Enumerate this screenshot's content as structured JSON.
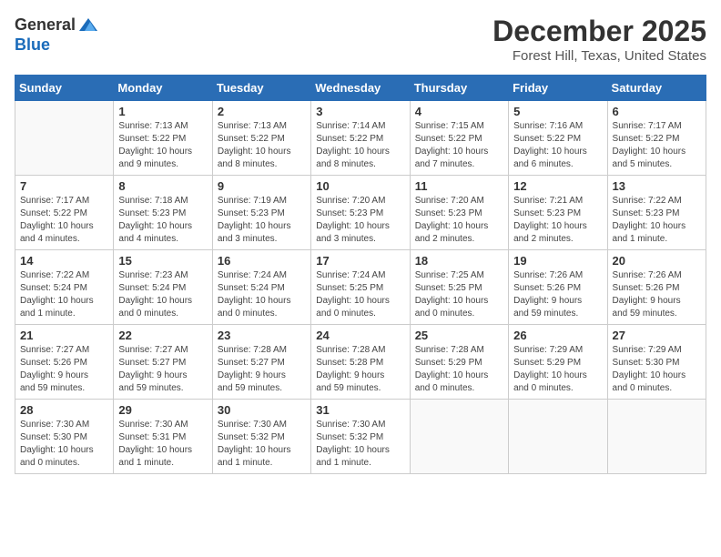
{
  "logo": {
    "general": "General",
    "blue": "Blue"
  },
  "title": "December 2025",
  "location": "Forest Hill, Texas, United States",
  "days_header": [
    "Sunday",
    "Monday",
    "Tuesday",
    "Wednesday",
    "Thursday",
    "Friday",
    "Saturday"
  ],
  "weeks": [
    [
      {
        "num": "",
        "info": ""
      },
      {
        "num": "1",
        "info": "Sunrise: 7:13 AM\nSunset: 5:22 PM\nDaylight: 10 hours\nand 9 minutes."
      },
      {
        "num": "2",
        "info": "Sunrise: 7:13 AM\nSunset: 5:22 PM\nDaylight: 10 hours\nand 8 minutes."
      },
      {
        "num": "3",
        "info": "Sunrise: 7:14 AM\nSunset: 5:22 PM\nDaylight: 10 hours\nand 8 minutes."
      },
      {
        "num": "4",
        "info": "Sunrise: 7:15 AM\nSunset: 5:22 PM\nDaylight: 10 hours\nand 7 minutes."
      },
      {
        "num": "5",
        "info": "Sunrise: 7:16 AM\nSunset: 5:22 PM\nDaylight: 10 hours\nand 6 minutes."
      },
      {
        "num": "6",
        "info": "Sunrise: 7:17 AM\nSunset: 5:22 PM\nDaylight: 10 hours\nand 5 minutes."
      }
    ],
    [
      {
        "num": "7",
        "info": "Sunrise: 7:17 AM\nSunset: 5:22 PM\nDaylight: 10 hours\nand 4 minutes."
      },
      {
        "num": "8",
        "info": "Sunrise: 7:18 AM\nSunset: 5:23 PM\nDaylight: 10 hours\nand 4 minutes."
      },
      {
        "num": "9",
        "info": "Sunrise: 7:19 AM\nSunset: 5:23 PM\nDaylight: 10 hours\nand 3 minutes."
      },
      {
        "num": "10",
        "info": "Sunrise: 7:20 AM\nSunset: 5:23 PM\nDaylight: 10 hours\nand 3 minutes."
      },
      {
        "num": "11",
        "info": "Sunrise: 7:20 AM\nSunset: 5:23 PM\nDaylight: 10 hours\nand 2 minutes."
      },
      {
        "num": "12",
        "info": "Sunrise: 7:21 AM\nSunset: 5:23 PM\nDaylight: 10 hours\nand 2 minutes."
      },
      {
        "num": "13",
        "info": "Sunrise: 7:22 AM\nSunset: 5:23 PM\nDaylight: 10 hours\nand 1 minute."
      }
    ],
    [
      {
        "num": "14",
        "info": "Sunrise: 7:22 AM\nSunset: 5:24 PM\nDaylight: 10 hours\nand 1 minute."
      },
      {
        "num": "15",
        "info": "Sunrise: 7:23 AM\nSunset: 5:24 PM\nDaylight: 10 hours\nand 0 minutes."
      },
      {
        "num": "16",
        "info": "Sunrise: 7:24 AM\nSunset: 5:24 PM\nDaylight: 10 hours\nand 0 minutes."
      },
      {
        "num": "17",
        "info": "Sunrise: 7:24 AM\nSunset: 5:25 PM\nDaylight: 10 hours\nand 0 minutes."
      },
      {
        "num": "18",
        "info": "Sunrise: 7:25 AM\nSunset: 5:25 PM\nDaylight: 10 hours\nand 0 minutes."
      },
      {
        "num": "19",
        "info": "Sunrise: 7:26 AM\nSunset: 5:26 PM\nDaylight: 9 hours\nand 59 minutes."
      },
      {
        "num": "20",
        "info": "Sunrise: 7:26 AM\nSunset: 5:26 PM\nDaylight: 9 hours\nand 59 minutes."
      }
    ],
    [
      {
        "num": "21",
        "info": "Sunrise: 7:27 AM\nSunset: 5:26 PM\nDaylight: 9 hours\nand 59 minutes."
      },
      {
        "num": "22",
        "info": "Sunrise: 7:27 AM\nSunset: 5:27 PM\nDaylight: 9 hours\nand 59 minutes."
      },
      {
        "num": "23",
        "info": "Sunrise: 7:28 AM\nSunset: 5:27 PM\nDaylight: 9 hours\nand 59 minutes."
      },
      {
        "num": "24",
        "info": "Sunrise: 7:28 AM\nSunset: 5:28 PM\nDaylight: 9 hours\nand 59 minutes."
      },
      {
        "num": "25",
        "info": "Sunrise: 7:28 AM\nSunset: 5:29 PM\nDaylight: 10 hours\nand 0 minutes."
      },
      {
        "num": "26",
        "info": "Sunrise: 7:29 AM\nSunset: 5:29 PM\nDaylight: 10 hours\nand 0 minutes."
      },
      {
        "num": "27",
        "info": "Sunrise: 7:29 AM\nSunset: 5:30 PM\nDaylight: 10 hours\nand 0 minutes."
      }
    ],
    [
      {
        "num": "28",
        "info": "Sunrise: 7:30 AM\nSunset: 5:30 PM\nDaylight: 10 hours\nand 0 minutes."
      },
      {
        "num": "29",
        "info": "Sunrise: 7:30 AM\nSunset: 5:31 PM\nDaylight: 10 hours\nand 1 minute."
      },
      {
        "num": "30",
        "info": "Sunrise: 7:30 AM\nSunset: 5:32 PM\nDaylight: 10 hours\nand 1 minute."
      },
      {
        "num": "31",
        "info": "Sunrise: 7:30 AM\nSunset: 5:32 PM\nDaylight: 10 hours\nand 1 minute."
      },
      {
        "num": "",
        "info": ""
      },
      {
        "num": "",
        "info": ""
      },
      {
        "num": "",
        "info": ""
      }
    ]
  ]
}
